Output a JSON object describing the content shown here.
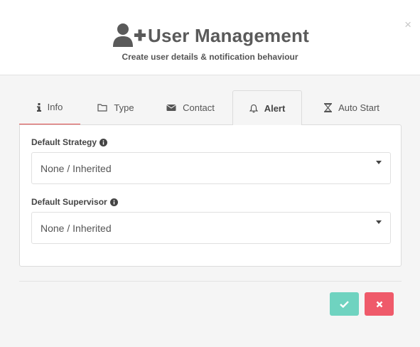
{
  "dialog": {
    "title": "User Management",
    "subtitle": "Create user details & notification behaviour",
    "close_label": "×"
  },
  "tabs": [
    {
      "label": "Info",
      "icon": "info-icon",
      "active": false,
      "underlined": true
    },
    {
      "label": "Type",
      "icon": "folder-icon",
      "active": false
    },
    {
      "label": "Contact",
      "icon": "envelope-icon",
      "active": false
    },
    {
      "label": "Alert",
      "icon": "bell-icon",
      "active": true
    },
    {
      "label": "Auto Start",
      "icon": "hourglass-icon",
      "active": false
    }
  ],
  "fields": {
    "strategy": {
      "label": "Default Strategy",
      "value": "None / Inherited"
    },
    "supervisor": {
      "label": "Default Supervisor",
      "value": "None / Inherited"
    }
  },
  "buttons": {
    "confirm": "check-icon",
    "cancel": "times-icon"
  },
  "colors": {
    "accent_underline": "#e04a4a",
    "confirm_button": "#6fd3c0",
    "cancel_button": "#ef5a6a"
  }
}
